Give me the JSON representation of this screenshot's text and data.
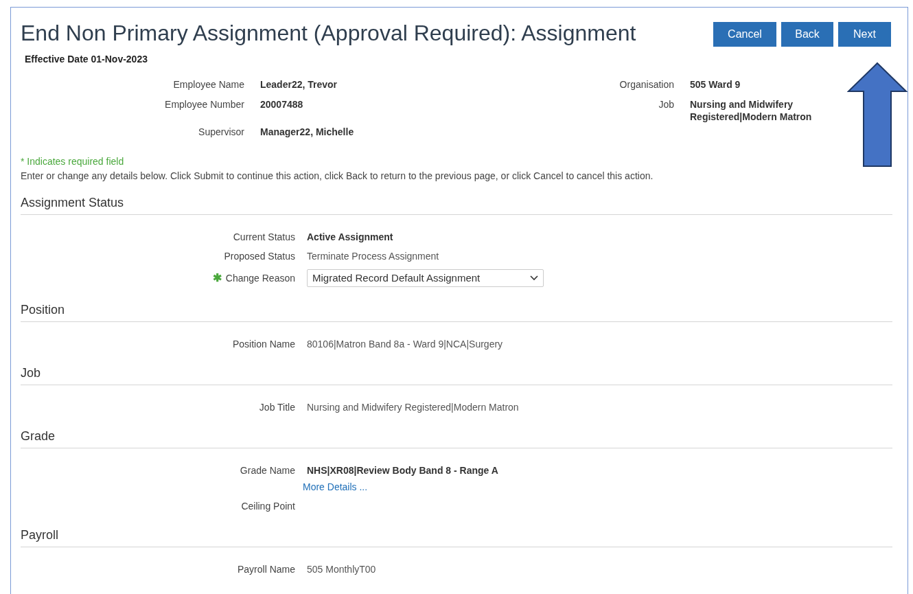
{
  "page": {
    "title": "End Non Primary Assignment (Approval Required): Assignment"
  },
  "buttons": [
    {
      "label": "Cancel"
    },
    {
      "label": "Back"
    },
    {
      "label": "Next"
    }
  ],
  "annotation": {
    "kind": "up-arrow"
  },
  "effective_date": "Effective Date 01-Nov-2023",
  "header_left": [
    {
      "label": "Employee Name",
      "value": "Leader22, Trevor"
    },
    {
      "label": "Employee Number",
      "value": "20007488"
    },
    {
      "label": "Supervisor",
      "value": "Manager22, Michelle"
    }
  ],
  "header_right": [
    {
      "label": "Organisation",
      "value": "505 Ward 9"
    },
    {
      "label": "Job",
      "value": "Nursing and Midwifery Registered|Modern Matron"
    }
  ],
  "required_note": "* Indicates required field",
  "required_marker": "✱",
  "instructions": "Enter or change any details below. Click Submit to continue this action, click Back to return to the previous page, or click Cancel to cancel this action.",
  "sections": [
    {
      "title": "Assignment Status",
      "fields": [
        {
          "label": "Current Status",
          "kind": "text",
          "value": "Active Assignment",
          "bold": true,
          "required": false
        },
        {
          "label": "Proposed Status",
          "kind": "text",
          "value": "Terminate Process Assignment",
          "bold": false,
          "required": false
        },
        {
          "label": "Change Reason",
          "kind": "select",
          "value": "Migrated Record Default Assignment",
          "required": true
        }
      ]
    },
    {
      "title": "Position",
      "fields": [
        {
          "label": "Position Name",
          "kind": "text",
          "value": "80106|Matron Band 8a - Ward 9|NCA|Surgery",
          "bold": false,
          "required": false
        }
      ]
    },
    {
      "title": "Job",
      "fields": [
        {
          "label": "Job Title",
          "kind": "text",
          "value": "Nursing and Midwifery Registered|Modern Matron",
          "bold": false,
          "required": false
        }
      ]
    },
    {
      "title": "Grade",
      "fields": [
        {
          "label": "Grade Name",
          "kind": "text",
          "value": "NHS|XR08|Review Body Band 8 - Range A",
          "bold": true,
          "required": false,
          "link": "More Details ..."
        },
        {
          "label": "Ceiling Point",
          "kind": "empty",
          "required": false
        }
      ]
    },
    {
      "title": "Payroll",
      "fields": [
        {
          "label": "Payroll Name",
          "kind": "text",
          "value": "505 MonthlyT00",
          "bold": false,
          "required": false
        }
      ]
    }
  ]
}
